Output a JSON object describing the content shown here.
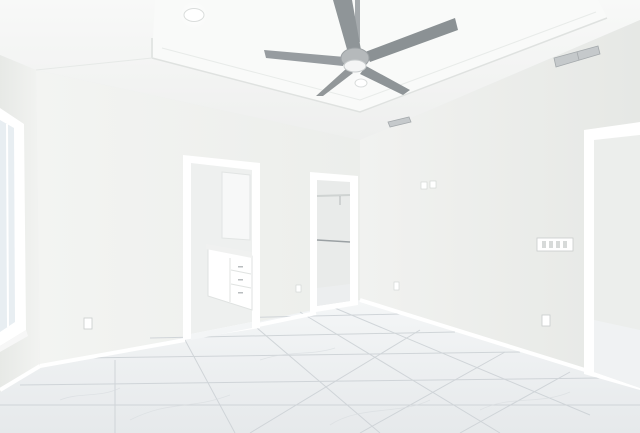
{
  "scene": {
    "room": "empty-bedroom",
    "features": [
      "tray-ceiling",
      "ceiling-fan",
      "recessed-lights",
      "hvac-vents",
      "bathroom-doorway",
      "closet-doorway",
      "window",
      "marble-look-tile-floor"
    ]
  },
  "watermark": {
    "text": ""
  },
  "colors": {
    "wall": "#f2f3f1",
    "wall_shade": "#e4e6e3",
    "ceiling": "#f6f7f6",
    "floor": "#eef0f1",
    "grout": "#c9ced2",
    "trim": "#ffffff",
    "fan_blade": "#8d9396",
    "fan_motor": "#b7bbbd"
  }
}
